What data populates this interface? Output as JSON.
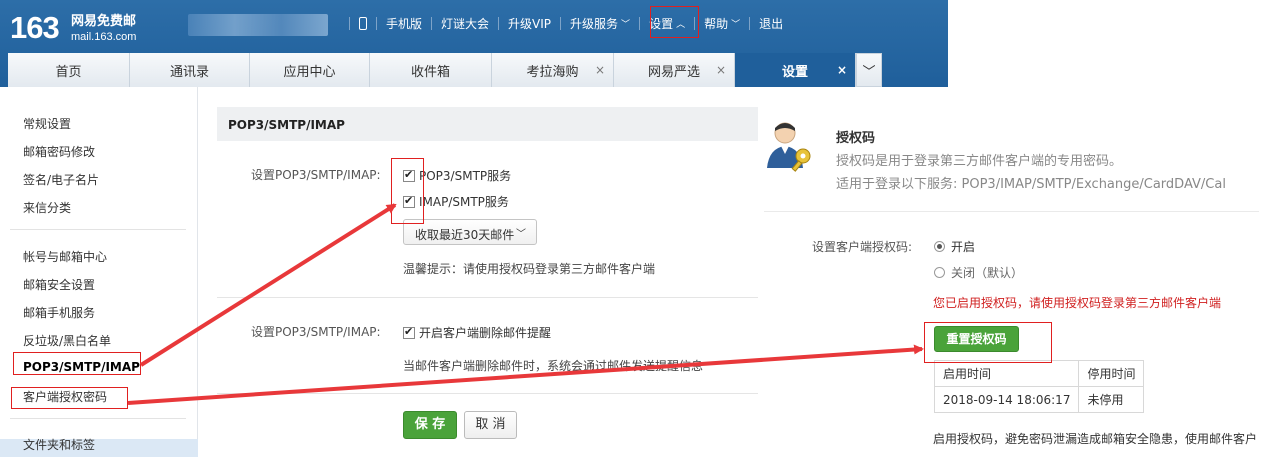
{
  "header": {
    "logo_number": "163",
    "logo_name": "网易免费邮",
    "logo_domain": "mail.163.com",
    "nav": [
      {
        "label": "手机版"
      },
      {
        "label": "灯谜大会"
      },
      {
        "label": "升级VIP"
      },
      {
        "label": "升级服务",
        "caret": "﹀"
      },
      {
        "label": "设置",
        "caret": "︿"
      },
      {
        "label": "帮助",
        "caret": "﹀"
      },
      {
        "label": "退出"
      }
    ]
  },
  "tabs": [
    {
      "label": "首页"
    },
    {
      "label": "通讯录"
    },
    {
      "label": "应用中心"
    },
    {
      "label": "收件箱"
    },
    {
      "label": "考拉海购",
      "close": "×"
    },
    {
      "label": "网易严选",
      "close": "×"
    },
    {
      "label": "设置",
      "close": "×"
    }
  ],
  "tabs_more": "﹀",
  "sidebar": {
    "group1": [
      "常规设置",
      "邮箱密码修改",
      "签名/电子名片",
      "来信分类"
    ],
    "group2": [
      "帐号与邮箱中心",
      "邮箱安全设置",
      "邮箱手机服务",
      "反垃圾/黑白名单",
      "POP3/SMTP/IMAP",
      "客户端授权密码"
    ],
    "group3": [
      "文件夹和标签"
    ]
  },
  "main": {
    "title": "POP3/SMTP/IMAP",
    "row1_label": "设置POP3/SMTP/IMAP:",
    "pop3_label": "POP3/SMTP服务",
    "imap_label": "IMAP/SMTP服务",
    "fetch_select": "收取最近30天邮件",
    "hint": "温馨提示：请使用授权码登录第三方邮件客户端",
    "row2_label": "设置POP3/SMTP/IMAP:",
    "delete_notice_label": "开启客户端删除邮件提醒",
    "delete_notice_desc": "当邮件客户端删除邮件时，系统会通过邮件发送提醒信息",
    "save_label": "保 存",
    "cancel_label": "取 消"
  },
  "auth": {
    "title": "授权码",
    "desc1": "授权码是用于登录第三方邮件客户端的专用密码。",
    "desc2": "适用于登录以下服务: POP3/IMAP/SMTP/Exchange/CardDAV/Cal",
    "setting_label": "设置客户端授权码:",
    "option_on": "开启",
    "option_off": "关闭（默认）",
    "warning": "您已启用授权码，请使用授权码登录第三方邮件客户端",
    "reset_label": "重置授权码",
    "table_headers": [
      "启用时间",
      "停用时间"
    ],
    "table_row": [
      "2018-09-14 18:06:17",
      "未停用"
    ],
    "bottom_note": "启用授权码，避免密码泄漏造成邮箱安全隐患，使用邮件客户"
  },
  "colors": {
    "header_blue": "#1f5f9b",
    "green_button": "#4aa33a",
    "warning_red": "#d02020",
    "annotation_red": "#e02020"
  }
}
